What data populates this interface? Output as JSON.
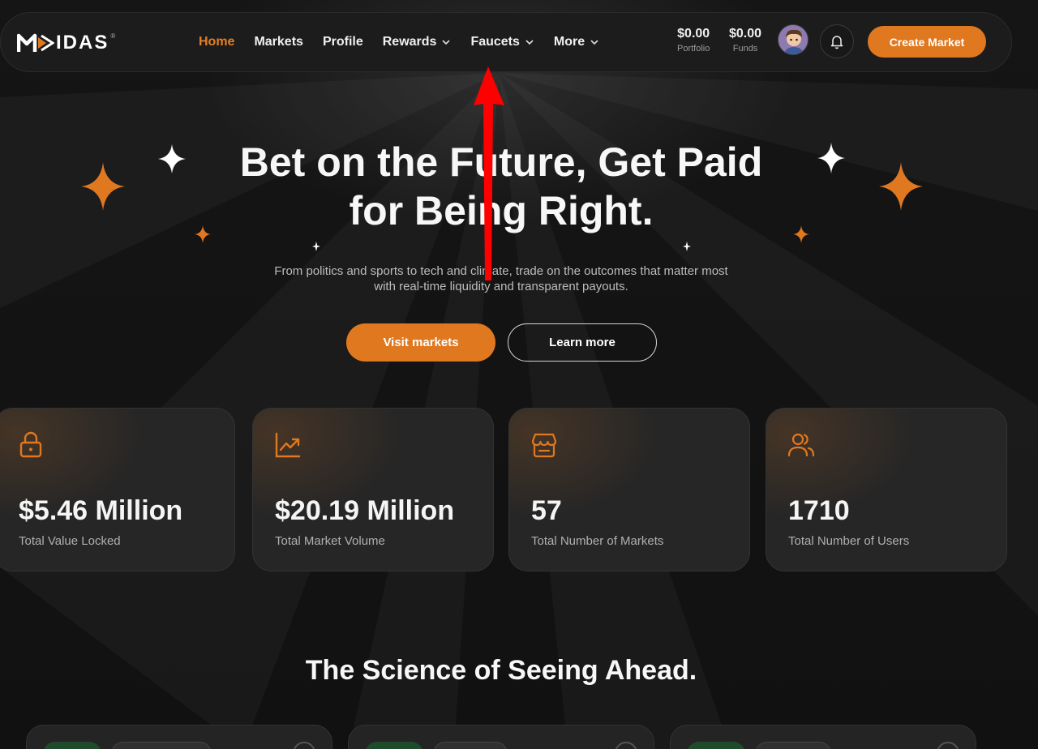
{
  "brand": {
    "logo_text": "IDAS",
    "registered_mark": "®"
  },
  "nav": {
    "items": [
      {
        "label": "Home",
        "active": true,
        "dropdown": false
      },
      {
        "label": "Markets",
        "active": false,
        "dropdown": false
      },
      {
        "label": "Profile",
        "active": false,
        "dropdown": false
      },
      {
        "label": "Rewards",
        "active": false,
        "dropdown": true
      },
      {
        "label": "Faucets",
        "active": false,
        "dropdown": true
      },
      {
        "label": "More",
        "active": false,
        "dropdown": true
      }
    ],
    "portfolio": {
      "amount": "$0.00",
      "label": "Portfolio"
    },
    "funds": {
      "amount": "$0.00",
      "label": "Funds"
    },
    "create_label": "Create Market"
  },
  "hero": {
    "title_line1": "Bet on the Future, Get Paid",
    "title_line2": "for Being Right.",
    "subtitle_line1": "From politics and sports to tech and climate, trade on the outcomes that matter most",
    "subtitle_line2": "with real-time liquidity and transparent payouts.",
    "primary_label": "Visit markets",
    "secondary_label": "Learn more"
  },
  "stats": [
    {
      "icon": "lock-icon",
      "value": "$5.46 Million",
      "label": "Total Value Locked"
    },
    {
      "icon": "trending-up-icon",
      "value": "$20.19 Million",
      "label": "Total Market Volume"
    },
    {
      "icon": "store-icon",
      "value": "57",
      "label": "Total Number of Markets"
    },
    {
      "icon": "users-icon",
      "value": "1710",
      "label": "Total Number of Users"
    }
  ],
  "section": {
    "title": "The Science of Seeing Ahead."
  },
  "colors": {
    "accent": "#e07820",
    "background": "#121212",
    "card": "#262626",
    "annotation_arrow": "#ff0000"
  }
}
